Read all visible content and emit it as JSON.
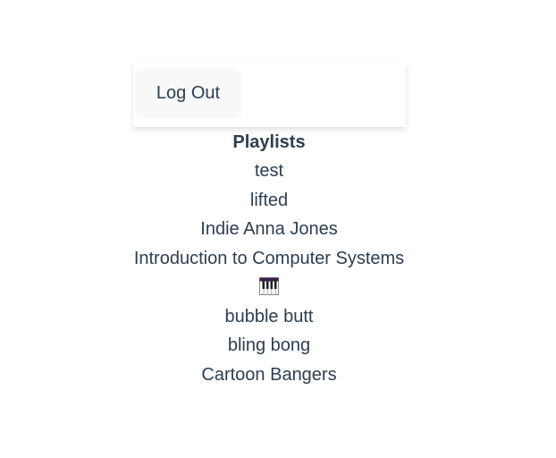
{
  "header": {
    "logout_label": "Log Out"
  },
  "playlists": {
    "heading": "Playlists",
    "items": [
      {
        "label": "test"
      },
      {
        "label": "lifted"
      },
      {
        "label": "Indie Anna Jones"
      },
      {
        "label": "Introduction to Computer Systems"
      },
      {
        "label": "",
        "icon": "piano-keyboard-icon"
      },
      {
        "label": "bubble butt"
      },
      {
        "label": "bling bong"
      },
      {
        "label": "Cartoon Bangers"
      }
    ]
  },
  "colors": {
    "text": "#2c3e50",
    "button_bg": "#f8f8f8",
    "piano_accent": "#3b1f4a"
  }
}
